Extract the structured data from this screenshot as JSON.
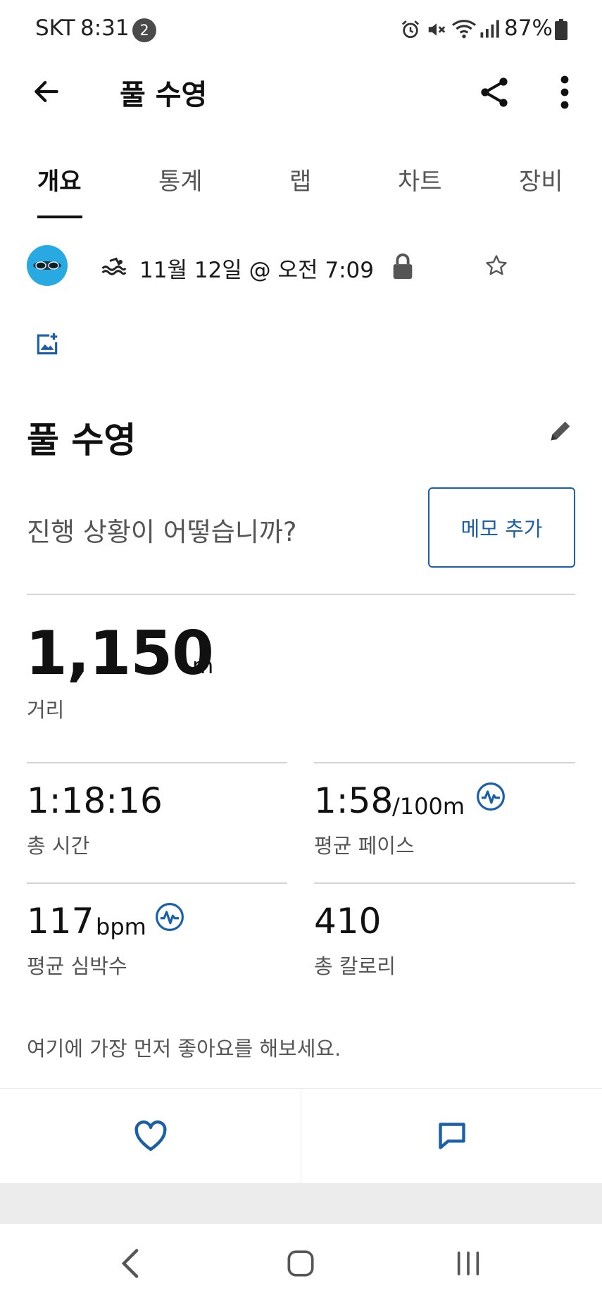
{
  "status_bar": {
    "carrier": "SKT",
    "time": "8:31",
    "notification_count": "2",
    "battery": "87%",
    "icons": [
      "alarm-icon",
      "mute-icon",
      "wifi-icon",
      "signal-icon",
      "battery-icon"
    ]
  },
  "header": {
    "title": "풀 수영",
    "icons": [
      "back-arrow-icon",
      "share-icon",
      "more-vert-icon"
    ]
  },
  "tabs": [
    {
      "label": "개요",
      "active": true
    },
    {
      "label": "통계",
      "active": false
    },
    {
      "label": "랩",
      "active": false
    },
    {
      "label": "차트",
      "active": false
    },
    {
      "label": "장비",
      "active": false
    }
  ],
  "activity": {
    "date": "11월 12일 @ 오전 7:09",
    "title": "풀 수영"
  },
  "note": {
    "prompt": "진행 상황이 어떻습니까?",
    "button_label": "메모 추가"
  },
  "distance": {
    "value": "1,150",
    "unit": "m",
    "label": "거리"
  },
  "stats": {
    "total_time": {
      "value": "1:18:16",
      "label": "총 시간"
    },
    "avg_pace": {
      "value": "1:58",
      "unit": "/100m",
      "label": "평균 페이스"
    },
    "avg_hr": {
      "value": "117",
      "unit": "bpm",
      "label": "평균 심박수"
    },
    "calories": {
      "value": "410",
      "label": "총 칼로리"
    }
  },
  "kudos_text": "여기에 가장 먼저 좋아요를 해보세요.",
  "colors": {
    "accent": "#1a5fa8",
    "avatar_bg": "#29a9e1"
  }
}
